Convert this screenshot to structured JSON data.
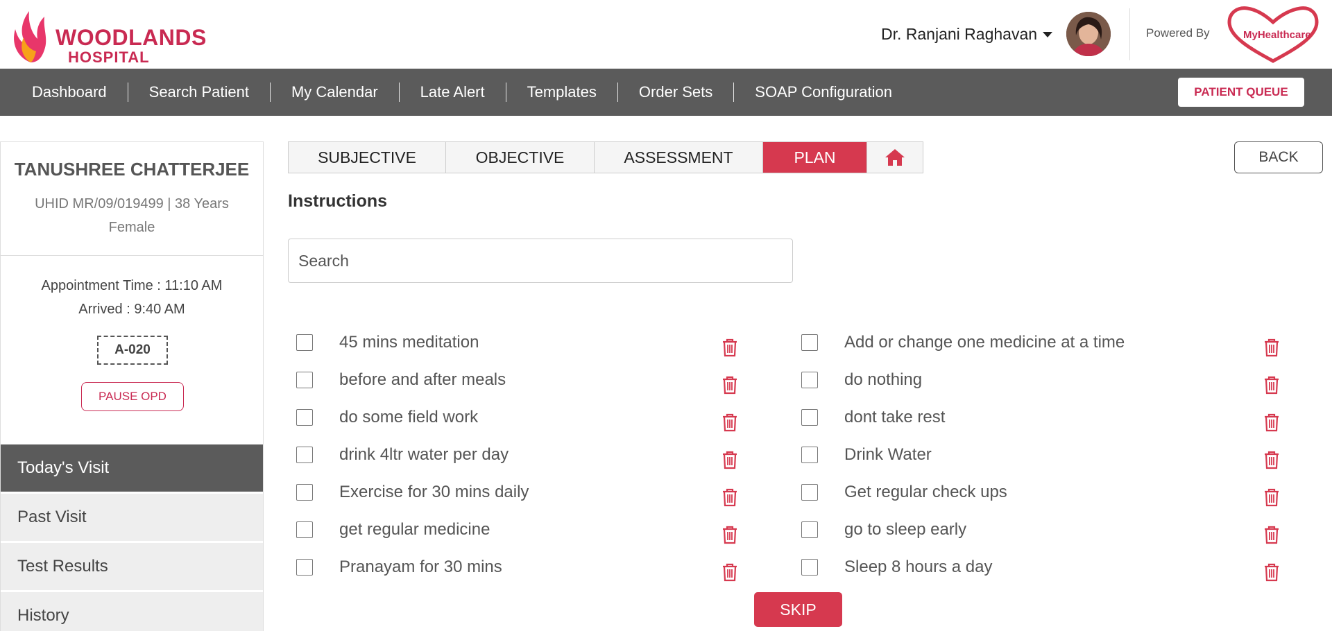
{
  "header": {
    "logo_main": "WOODLANDS",
    "logo_sub": "HOSPITAL",
    "user_name": "Dr. Ranjani Raghavan",
    "powered_by": "Powered By",
    "partner_logo_text": "MyHealthcare"
  },
  "nav": {
    "items": [
      "Dashboard",
      "Search Patient",
      "My Calendar",
      "Late Alert",
      "Templates",
      "Order Sets",
      "SOAP Configuration"
    ],
    "queue_label": "PATIENT QUEUE"
  },
  "patient": {
    "name": "TANUSHREE CHATTERJEE",
    "uhid_line": "UHID MR/09/019499 | 38 Years",
    "gender": "Female",
    "appointment": "Appointment Time : 11:10 AM",
    "arrived": "Arrived : 9:40 AM",
    "token": "A-020",
    "pause_label": "PAUSE OPD"
  },
  "side_menu": [
    "Today's Visit",
    "Past Visit",
    "Test Results",
    "History"
  ],
  "tabs": [
    "SUBJECTIVE",
    "OBJECTIVE",
    "ASSESSMENT",
    "PLAN"
  ],
  "active_tab": "PLAN",
  "back_label": "BACK",
  "section_title": "Instructions",
  "search": {
    "placeholder": "Search",
    "value": ""
  },
  "instructions_left": [
    "45 mins meditation",
    "before and after meals",
    "do some field work",
    "drink 4ltr water per day",
    "Exercise for 30 mins daily",
    "get regular medicine",
    "Pranayam for 30 mins"
  ],
  "instructions_right": [
    "Add or change one medicine at a time",
    "do nothing",
    "dont take rest",
    "Drink Water",
    "Get regular check ups",
    "go to sleep early",
    "Sleep 8 hours a day"
  ],
  "skip_label": "SKIP",
  "colors": {
    "accent": "#d6394f",
    "nav_bg": "#5b5b5b",
    "brand": "#c92a52"
  }
}
